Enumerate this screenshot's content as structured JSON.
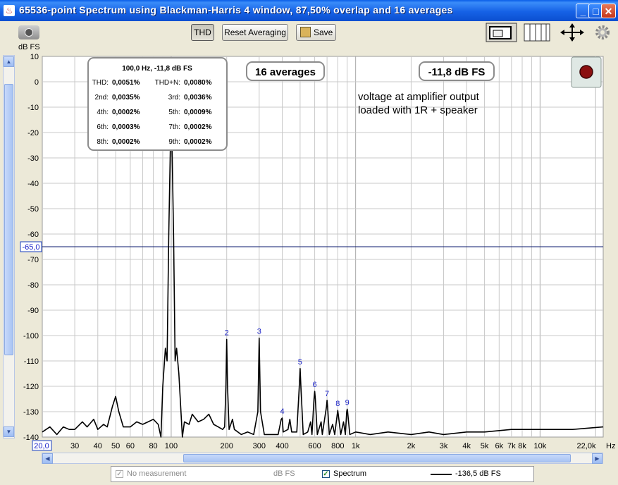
{
  "window": {
    "title": "65536-point Spectrum using Blackman-Harris 4 window, 87,50% overlap and 16 averages",
    "minimize_glyph": "_",
    "maximize_glyph": "□",
    "close_glyph": "✕"
  },
  "toolbar": {
    "thd_label": "THD",
    "reset_label": "Reset Averaging",
    "save_label": "Save"
  },
  "icons": {
    "camera": "camera-icon",
    "layout_single": "single-panel-layout-icon",
    "layout_columns": "columns-layout-icon",
    "fit": "fit-arrows-icon",
    "settings": "gear-icon",
    "record": "record-icon",
    "save": "save-icon"
  },
  "axis": {
    "y_unit": "dB FS",
    "x_unit": "Hz",
    "x_start_label": "20,0",
    "x_end_label": "22,0k"
  },
  "thd_panel": {
    "header": "100,0 Hz, -11,8 dB FS",
    "rows": [
      {
        "l1": "THD:",
        "v1": "0,0051%",
        "l2": "THD+N:",
        "v2": "0,0080%"
      },
      {
        "l1": "2nd:",
        "v1": "0,0035%",
        "l2": "3rd:",
        "v2": "0,0036%"
      },
      {
        "l1": "4th:",
        "v1": "0,0002%",
        "l2": "5th:",
        "v2": "0,0009%"
      },
      {
        "l1": "6th:",
        "v1": "0,0003%",
        "l2": "7th:",
        "v2": "0,0002%"
      },
      {
        "l1": "8th:",
        "v1": "0,0002%",
        "l2": "9th:",
        "v2": "0,0002%"
      }
    ]
  },
  "averages_label": "16 averages",
  "level_label": "-11,8 dB FS",
  "annotation": [
    "voltage at amplifier output",
    "loaded with 1R + speaker"
  ],
  "cursor_label": "-65,0",
  "legend": {
    "no_measurement": "No measurement",
    "unit": "dB FS",
    "spectrum": "Spectrum",
    "spectrum_value": "-136,5 dB FS"
  },
  "colors": {
    "plot_bg": "#ffffff",
    "grid": "#c8c8c8",
    "trace": "#000000",
    "cursor": "#0b1a6e",
    "harmonic_label": "#1a22c8"
  },
  "chart_data": {
    "type": "line",
    "xscale": "log",
    "xlim": [
      20,
      22000
    ],
    "ylim": [
      -140,
      10
    ],
    "yticks": [
      10,
      0,
      -10,
      -20,
      -30,
      -40,
      -50,
      -60,
      -70,
      -80,
      -90,
      -100,
      -110,
      -120,
      -130,
      -140
    ],
    "xticks": [
      {
        "v": 30,
        "label": "30"
      },
      {
        "v": 40,
        "label": "40"
      },
      {
        "v": 50,
        "label": "50"
      },
      {
        "v": 60,
        "label": "60"
      },
      {
        "v": 80,
        "label": "80"
      },
      {
        "v": 100,
        "label": "100"
      },
      {
        "v": 200,
        "label": "200"
      },
      {
        "v": 300,
        "label": "300"
      },
      {
        "v": 400,
        "label": "400"
      },
      {
        "v": 600,
        "label": "600"
      },
      {
        "v": 800,
        "label": "800"
      },
      {
        "v": 1000,
        "label": "1k"
      },
      {
        "v": 2000,
        "label": "2k"
      },
      {
        "v": 3000,
        "label": "3k"
      },
      {
        "v": 4000,
        "label": "4k"
      },
      {
        "v": 5000,
        "label": "5k"
      },
      {
        "v": 6000,
        "label": "6k"
      },
      {
        "v": 7000,
        "label": "7k"
      },
      {
        "v": 8000,
        "label": "8k"
      },
      {
        "v": 10000,
        "label": "10k"
      }
    ],
    "cursor_y": -65,
    "fundamental": {
      "freq": 100,
      "level": -11.8
    },
    "harmonics": [
      {
        "n": 2,
        "freq": 200,
        "level": -101.5
      },
      {
        "n": 3,
        "freq": 300,
        "level": -101
      },
      {
        "n": 4,
        "freq": 400,
        "level": -132.5
      },
      {
        "n": 5,
        "freq": 500,
        "level": -113
      },
      {
        "n": 6,
        "freq": 600,
        "level": -122
      },
      {
        "n": 7,
        "freq": 700,
        "level": -125.5
      },
      {
        "n": 8,
        "freq": 800,
        "level": -129.5
      },
      {
        "n": 9,
        "freq": 900,
        "level": -129
      }
    ],
    "trace": [
      [
        20,
        -138
      ],
      [
        22,
        -136
      ],
      [
        24,
        -139
      ],
      [
        26,
        -136
      ],
      [
        28,
        -137
      ],
      [
        30,
        -137
      ],
      [
        33,
        -134
      ],
      [
        35,
        -136
      ],
      [
        38,
        -133
      ],
      [
        40,
        -137
      ],
      [
        43,
        -135
      ],
      [
        45,
        -136
      ],
      [
        48,
        -128
      ],
      [
        50,
        -124
      ],
      [
        52,
        -130
      ],
      [
        55,
        -136
      ],
      [
        60,
        -136
      ],
      [
        65,
        -134
      ],
      [
        70,
        -135
      ],
      [
        75,
        -134
      ],
      [
        80,
        -133
      ],
      [
        85,
        -135
      ],
      [
        88,
        -140
      ],
      [
        90,
        -120
      ],
      [
        93,
        -105
      ],
      [
        95,
        -110
      ],
      [
        97,
        -60
      ],
      [
        99,
        -25
      ],
      [
        100,
        -11.8
      ],
      [
        101,
        -25
      ],
      [
        103,
        -60
      ],
      [
        105,
        -110
      ],
      [
        107,
        -105
      ],
      [
        110,
        -115
      ],
      [
        113,
        -130
      ],
      [
        115,
        -140
      ],
      [
        118,
        -134
      ],
      [
        125,
        -135
      ],
      [
        130,
        -131
      ],
      [
        140,
        -134
      ],
      [
        150,
        -133
      ],
      [
        160,
        -131
      ],
      [
        170,
        -135
      ],
      [
        180,
        -136
      ],
      [
        190,
        -137
      ],
      [
        195,
        -136
      ],
      [
        198,
        -120
      ],
      [
        200,
        -101.5
      ],
      [
        202,
        -120
      ],
      [
        206,
        -137
      ],
      [
        215,
        -133
      ],
      [
        220,
        -137
      ],
      [
        240,
        -139
      ],
      [
        260,
        -138
      ],
      [
        280,
        -139
      ],
      [
        295,
        -130
      ],
      [
        300,
        -101
      ],
      [
        305,
        -130
      ],
      [
        320,
        -139
      ],
      [
        350,
        -139
      ],
      [
        380,
        -139
      ],
      [
        395,
        -133
      ],
      [
        400,
        -132.5
      ],
      [
        405,
        -138
      ],
      [
        430,
        -137
      ],
      [
        440,
        -133
      ],
      [
        450,
        -138
      ],
      [
        480,
        -138
      ],
      [
        495,
        -120
      ],
      [
        500,
        -113
      ],
      [
        505,
        -120
      ],
      [
        520,
        -139
      ],
      [
        550,
        -138
      ],
      [
        570,
        -134
      ],
      [
        580,
        -139
      ],
      [
        595,
        -125
      ],
      [
        600,
        -122
      ],
      [
        605,
        -125
      ],
      [
        620,
        -139
      ],
      [
        650,
        -134
      ],
      [
        660,
        -139
      ],
      [
        695,
        -128
      ],
      [
        700,
        -125.5
      ],
      [
        705,
        -128
      ],
      [
        720,
        -139
      ],
      [
        750,
        -135
      ],
      [
        770,
        -139
      ],
      [
        795,
        -131
      ],
      [
        800,
        -129.5
      ],
      [
        805,
        -131
      ],
      [
        830,
        -139
      ],
      [
        860,
        -134
      ],
      [
        880,
        -139
      ],
      [
        895,
        -130
      ],
      [
        900,
        -129
      ],
      [
        905,
        -130
      ],
      [
        930,
        -139
      ],
      [
        1000,
        -138
      ],
      [
        1200,
        -139
      ],
      [
        1500,
        -138
      ],
      [
        2000,
        -139
      ],
      [
        2500,
        -138
      ],
      [
        3000,
        -139
      ],
      [
        4000,
        -138
      ],
      [
        5000,
        -138
      ],
      [
        7000,
        -137
      ],
      [
        10000,
        -137
      ],
      [
        15000,
        -137
      ],
      [
        22000,
        -136
      ]
    ]
  }
}
